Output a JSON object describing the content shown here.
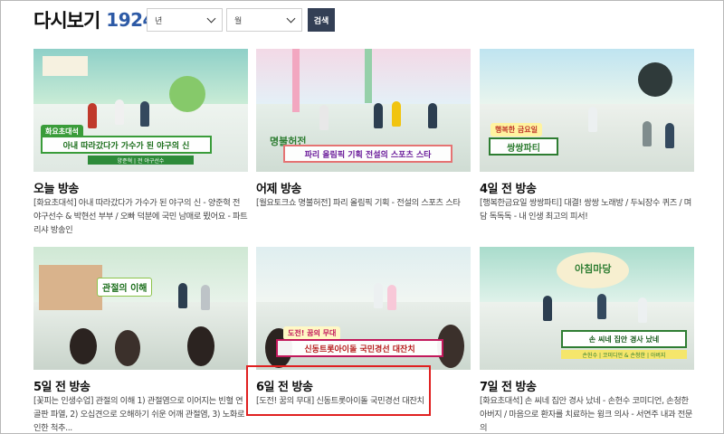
{
  "header": {
    "title": "다시보기",
    "count": "1924"
  },
  "filters": {
    "year": {
      "value": "년"
    },
    "month": {
      "value": "월"
    },
    "search_label": "검색"
  },
  "episodes": [
    {
      "title": "오늘 방송",
      "description": "[화요초대석] 아내 따라갔다가 가수가 된 야구의 신 - 양준혁 전 야구선수 & 박현선 부부 / 오빠 덕분에 국민 남매로 뜄어요 - 파트리샤 방송인",
      "thumb_caption": "화요초대석",
      "thumb_banner": "아내 따라갔다가 가수가 된 야구의 신",
      "thumb_sub": "양준혁 | 전 야구선수"
    },
    {
      "title": "어제 방송",
      "description": "[월요토크쇼 명불허전] 파리 올림픽 기획 - 전설의 스포츠 스타",
      "thumb_caption": "명불허전",
      "thumb_banner": "파리 올림픽 기획  전설의 스포츠 스타",
      "thumb_sub": ""
    },
    {
      "title": "4일 전 방송",
      "description": "[행복한금요일 쌍쌍파티] 대결! 쌍쌍 노래방 / 두뇌장수 퀴즈 / 며담 독독독 - 내 인생 최고의 피서!",
      "thumb_caption": "행복한 금요일",
      "thumb_banner": "쌍쌍파티",
      "thumb_sub": ""
    },
    {
      "title": "5일 전 방송",
      "description": "[꽃피는 인생수업] 관절의 이해 1) 관절염으로 이어지는 빈혈 연골판 파열, 2) 오십견으로 오해하기 쉬운 어깨 관절염, 3) 노화로 인한 척추...",
      "thumb_caption": "관절의 이해",
      "thumb_banner": "",
      "thumb_sub": ""
    },
    {
      "title": "6일 전 방송",
      "description": "[도전! 꿈의 무대] 신동트롯아이돌 국민경선 대잔치",
      "thumb_caption": "도전! 꿈의 무대",
      "thumb_banner": "신동트롯아이돌 국민경선 대잔치",
      "thumb_sub": ""
    },
    {
      "title": "7일 전 방송",
      "description": "[화요초대석] 손 씨네 집안 경사 났네 - 손헌수 코미디언, 손청한 아버지 / 마음으로 환자를 치료하는 윙크 의사 - 서연주 내과 전문의",
      "thumb_caption": "아침마당",
      "thumb_banner": "손 씨네 집안 경사 났네",
      "thumb_sub": "손헌수 | 코미디언 & 손청한 | 아버지"
    }
  ],
  "colors": {
    "accent_blue": "#2d5aa6",
    "search_button": "#333f55",
    "highlight_box": "#e02020",
    "banner_green": "#3a9c3a"
  }
}
